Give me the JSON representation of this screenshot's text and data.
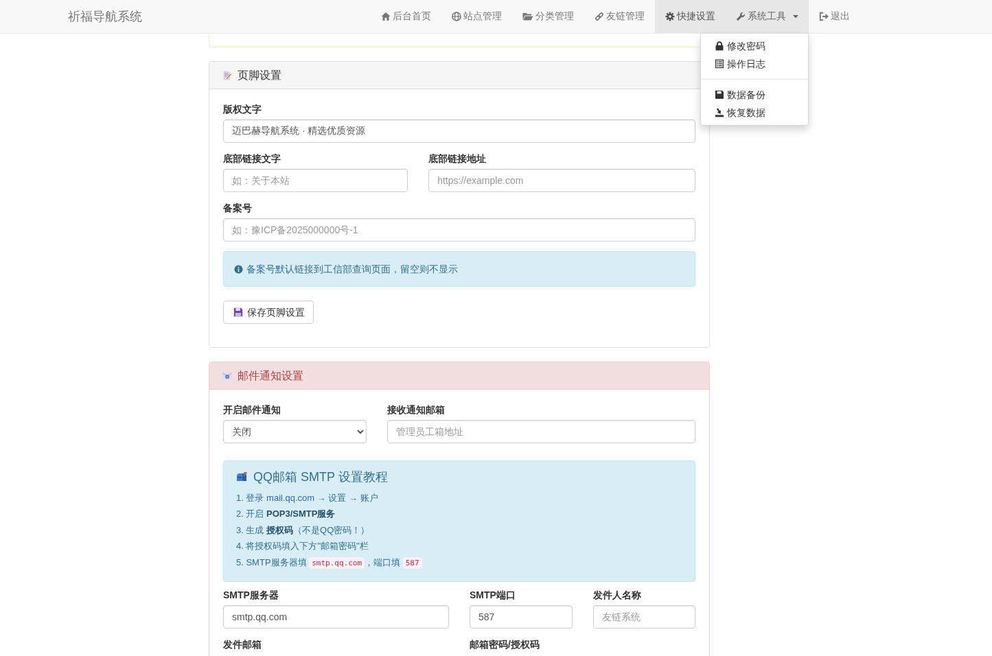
{
  "navbar": {
    "brand": "祈福导航系统",
    "items": [
      {
        "label": "后台首页",
        "kind": "link",
        "selected": false,
        "expanded": false
      },
      {
        "label": "站点管理",
        "kind": "link",
        "selected": false,
        "expanded": false
      },
      {
        "label": "分类管理",
        "kind": "link",
        "selected": false,
        "expanded": false
      },
      {
        "label": "友链管理",
        "kind": "link",
        "selected": false,
        "expanded": false
      },
      {
        "label": "快捷设置",
        "kind": "link",
        "selected": true,
        "expanded": false
      },
      {
        "label": "系统工具",
        "kind": "dropdown",
        "selected": false,
        "expanded": true,
        "menu": {
          "groups": [
            {
              "items": [
                {
                  "label": "修改密码"
                },
                {
                  "label": "操作日志"
                }
              ]
            },
            {
              "items": [
                {
                  "label": "数据备份"
                },
                {
                  "label": "恢复数据"
                }
              ]
            }
          ]
        }
      },
      {
        "label": "退出",
        "kind": "link",
        "selected": false,
        "expanded": false
      }
    ]
  },
  "footer_panel": {
    "title": "页脚设置",
    "fields": [
      {
        "label": "版权文字",
        "kind": "input",
        "value": "迈巴赫导航系统 · 精选优质资源"
      },
      {
        "label": "底部链接文字",
        "kind": "input",
        "placeholder": "如：关于本站"
      },
      {
        "label": "底部链接地址",
        "kind": "input",
        "placeholder": "https://example.com"
      },
      {
        "label": "备案号",
        "kind": "input",
        "placeholder": "如：豫ICP备2025000000号-1"
      }
    ],
    "alert": "备案号默认链接到工信部查询页面，留空则不显示",
    "save_button": "保存页脚设置"
  },
  "mail_panel": {
    "title": "邮件通知设置",
    "top_fields": [
      {
        "label": "开启邮件通知",
        "kind": "select",
        "value": "关闭"
      },
      {
        "label": "接收通知邮箱",
        "kind": "input",
        "placeholder": "管理员工箱地址"
      }
    ],
    "tutorial": {
      "title": "QQ邮箱 SMTP 设置教程",
      "steps": [
        {
          "parts": [
            {
              "kind": "text",
              "text": "1. 登录 "
            },
            {
              "kind": "link",
              "text": "mail.qq.com"
            },
            {
              "kind": "text",
              "text": " → 设置 → 账户"
            }
          ]
        },
        {
          "parts": [
            {
              "kind": "text",
              "text": "2. 开启 **POP3/SMTP服务**"
            }
          ]
        },
        {
          "parts": [
            {
              "kind": "text",
              "text": "3. 生成 **授权码**（不是QQ密码！）"
            }
          ]
        },
        {
          "parts": [
            {
              "kind": "text",
              "text": "4. 将授权码填入下方\"邮箱密码\"栏"
            }
          ]
        },
        {
          "parts": [
            {
              "kind": "text",
              "text": "5. SMTP服务器填 "
            },
            {
              "kind": "code",
              "text": "smtp.qq.com"
            },
            {
              "kind": "text",
              "text": "，端口填 "
            },
            {
              "kind": "code",
              "text": "587"
            }
          ]
        }
      ]
    },
    "fields": [
      {
        "label": "SMTP服务器",
        "kind": "input",
        "value": "smtp.qq.com"
      },
      {
        "label": "SMTP端口",
        "kind": "input",
        "value": "587"
      },
      {
        "label": "发件人名称",
        "kind": "input",
        "placeholder": "友链系统"
      },
      {
        "label": "发件邮箱",
        "kind": "label"
      },
      {
        "label": "邮箱密码/授权码",
        "kind": "label"
      }
    ]
  }
}
